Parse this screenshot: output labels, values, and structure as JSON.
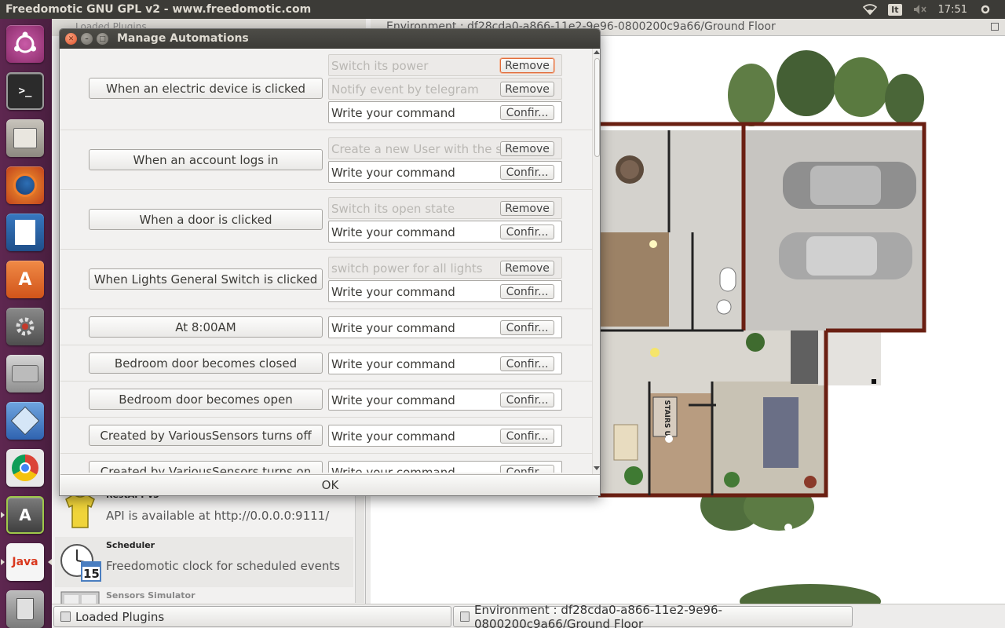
{
  "top_panel": {
    "title": "Freedomotic GNU GPL v2 - www.freedomotic.com",
    "keyboard_layout": "It",
    "time": "17:51"
  },
  "launcher": {
    "items": [
      "ubuntu-dash",
      "terminal",
      "file-manager",
      "firefox",
      "libreoffice-writer",
      "software-center",
      "system-settings",
      "disk-utility",
      "virtualbox",
      "chrome",
      "freedomotic",
      "java",
      "trash"
    ]
  },
  "left_pane": {
    "tab_label": "Loaded Plugins",
    "plugins": [
      {
        "name": "RestAPI-v3",
        "description": "API is available at http://0.0.0.0:9111/"
      },
      {
        "name": "Scheduler",
        "description": "Freedomotic clock for scheduled events"
      },
      {
        "name": "Sensors Simulator",
        "description": ""
      }
    ],
    "calendar_day": "15"
  },
  "env_pane": {
    "tab_label": "Environment : df28cda0-a866-11e2-9e96-0800200c9a66/Ground Floor",
    "stairs_label": "STAIRS UP"
  },
  "bottom_bar": {
    "loaded_plugins": "Loaded Plugins",
    "environment": "Environment : df28cda0-a866-11e2-9e96-0800200c9a66/Ground Floor"
  },
  "dialog": {
    "title": "Manage Automations",
    "ok_label": "OK",
    "remove_label": "Remove",
    "confirm_label": "Confir...",
    "command_placeholder": "Write your command",
    "automations": [
      {
        "trigger": "When an electric device is clicked",
        "commands": [
          "Switch its power",
          "Notify event by telegram"
        ]
      },
      {
        "trigger": "When an account logs in",
        "commands": [
          "Create a new User with the same"
        ]
      },
      {
        "trigger": "When a door is clicked",
        "commands": [
          "Switch its open state"
        ]
      },
      {
        "trigger": "When Lights General Switch is clicked",
        "commands": [
          "switch power for all lights"
        ]
      },
      {
        "trigger": "At 8:00AM",
        "commands": []
      },
      {
        "trigger": "Bedroom door becomes closed",
        "commands": []
      },
      {
        "trigger": "Bedroom door becomes open",
        "commands": []
      },
      {
        "trigger": "Created by VariousSensors turns off",
        "commands": []
      },
      {
        "trigger": "Created by VariousSensors turns on",
        "commands": []
      }
    ]
  }
}
